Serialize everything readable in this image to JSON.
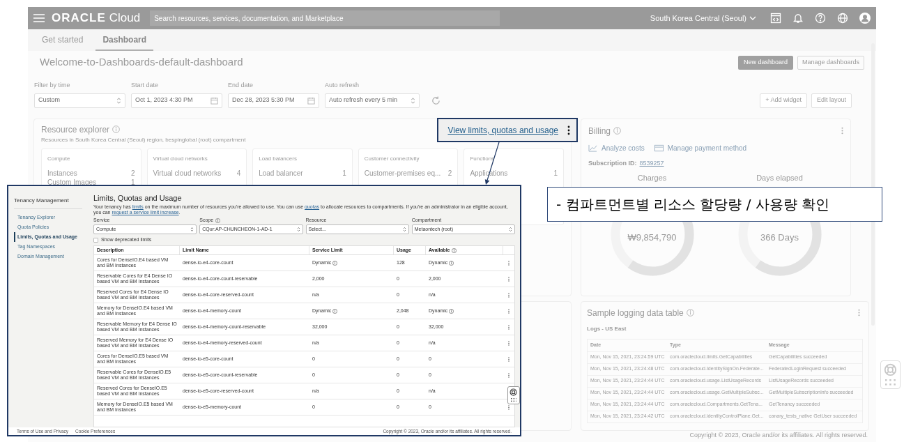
{
  "topbar": {
    "logo_brand": "ORACLE",
    "logo_product": "Cloud",
    "search_placeholder": "Search resources, services, documentation, and Marketplace",
    "region": "South Korea Central (Seoul)"
  },
  "tabs": [
    {
      "label": "Get started",
      "selected": false
    },
    {
      "label": "Dashboard",
      "selected": true
    }
  ],
  "dashboard": {
    "title": "Welcome-to-Dashboards-default-dashboard",
    "buttons": [
      {
        "label": "New dashboard",
        "kind": "primary"
      },
      {
        "label": "Manage dashboards",
        "kind": "secondary"
      }
    ]
  },
  "filters": [
    {
      "label": "Filter by time",
      "value": "Custom",
      "kind": "select"
    },
    {
      "label": "Start date",
      "value": "Oct 1, 2023 4:30 PM",
      "kind": "date"
    },
    {
      "label": "End date",
      "value": "Dec 28, 2023 5:30 PM",
      "kind": "date"
    },
    {
      "label": "Auto refresh",
      "value": "Auto refresh every 5 min",
      "kind": "select"
    }
  ],
  "layout_buttons": [
    "+ Add widget",
    "Edit layout"
  ],
  "resource_explorer": {
    "title": "Resource explorer",
    "subtitle": "Resources in South Korea Central (Seoul) region, bespinglobal (root) compartment",
    "tiles": [
      {
        "title": "Compute",
        "rows": [
          {
            "label": "Instances",
            "count": "2"
          },
          {
            "label": "Custom Images",
            "count": "1"
          }
        ]
      },
      {
        "title": "Virtual cloud networks",
        "rows": [
          {
            "label": "Virtual cloud networks",
            "count": "4"
          }
        ]
      },
      {
        "title": "Load balancers",
        "rows": [
          {
            "label": "Load balancer",
            "count": "1"
          }
        ]
      },
      {
        "title": "Customer connectivity",
        "rows": [
          {
            "label": "Customer-premises eq...",
            "count": "2"
          }
        ]
      },
      {
        "title": "Functions",
        "rows": [
          {
            "label": "Applications",
            "count": "1"
          }
        ]
      }
    ]
  },
  "billing": {
    "title": "Billing",
    "actions": [
      {
        "label": "Analyze costs",
        "kind": "chart"
      },
      {
        "label": "Manage payment method",
        "kind": "card"
      }
    ],
    "subscription_label": "Subscription ID:",
    "subscription_id": "8539257",
    "gauges": [
      {
        "title": "Charges",
        "reading": "₩9,854,790"
      },
      {
        "title": "Days elapsed",
        "reading": "366 Days"
      }
    ]
  },
  "logging": {
    "title": "Sample logging data table",
    "table_title": "Logs - US East",
    "columns": [
      "Date",
      "Type",
      "Message"
    ],
    "rows": [
      [
        "Mon, Nov 15, 2021, 23:24:59 UTC",
        "com.oraclecloud.limits.GetCapabilities",
        "GetCapabilities succeeded"
      ],
      [
        "Mon, Nov 15, 2021, 23:24:48 UTC",
        "com.oraclecloud.IdentitySignOn.Federate...",
        "FederatedLoginRequest succeeded"
      ],
      [
        "Mon, Nov 15, 2021, 23:24:44 UTC",
        "com.oraclecloud.usage.ListUsageRecords",
        "ListUsageRecords succeeded"
      ],
      [
        "Mon, Nov 15, 2021, 23:24:44 UTC",
        "com.oraclecloud.usage.GetMultipleSubsc...",
        "GetMultipleSubscriptionInfo succeeded"
      ],
      [
        "Mon, Nov 15, 2021, 23:24:44 UTC",
        "com.oraclecloud.Compartments.GetTena...",
        "GetTenancy succeeded"
      ],
      [
        "Mon, Nov 15, 2021, 23:24:42 UTC",
        "com.oraclecloud.identityControlPlane.Get...",
        "canary_tests_native GetUser succeeded"
      ]
    ]
  },
  "footer": "Copyright © 2023, Oracle and/or its affiliates. All rights reserved.",
  "callout": {
    "link": "View limits, quotas and usage"
  },
  "annotation": "- 컴파트먼트별 리소스 할당량 / 사용량 확인",
  "inset": {
    "sidebar_title": "Tenancy Management",
    "nav": [
      {
        "label": "Tenancy Explorer",
        "selected": false
      },
      {
        "label": "Quota Policies",
        "selected": false
      },
      {
        "label": "Limits, Quotas and Usage",
        "selected": true
      },
      {
        "label": "Tag Namespaces",
        "selected": false
      },
      {
        "label": "Domain Management",
        "selected": false
      }
    ],
    "title": "Limits, Quotas and Usage",
    "description": [
      {
        "text": "Your tenancy has ",
        "link": false
      },
      {
        "text": "limits",
        "link": true
      },
      {
        "text": " on the maximum number of resources you're allowed to use. You can use ",
        "link": false
      },
      {
        "text": "quotas",
        "link": true
      },
      {
        "text": " to allocate resources to compartments. If you're an administrator in an eligible account, you can ",
        "link": false
      },
      {
        "text": "request a service limit increase",
        "link": true
      },
      {
        "text": ".",
        "link": false
      }
    ],
    "selects": [
      {
        "label": "Service",
        "value": "Compute",
        "info": false
      },
      {
        "label": "Scope",
        "value": "CQur:AP-CHUNCHEON-1-AD-1",
        "info": true
      },
      {
        "label": "Resource",
        "value": "Select...",
        "info": false
      },
      {
        "label": "Compartment",
        "value": "Metaontech (root)",
        "info": false
      }
    ],
    "deprecated": {
      "label": "Show deprecated limits",
      "checked": false
    },
    "columns": [
      {
        "label": "Description",
        "info": false
      },
      {
        "label": "Limit Name",
        "info": false
      },
      {
        "label": "Service Limit",
        "info": false
      },
      {
        "label": "Usage",
        "info": false
      },
      {
        "label": "Available",
        "info": true
      }
    ],
    "rows": [
      {
        "description": "Cores for DenseIO.E4 based VM and BM Instances",
        "limit_name": "dense-io-e4-core-count",
        "service_limit": "Dynamic",
        "usage": "128",
        "available": "Dynamic",
        "info": true
      },
      {
        "description": "Reservable Cores for E4 Dense IO based VM and BM Instances",
        "limit_name": "dense-io-e4-core-count-reservable",
        "service_limit": "2,000",
        "usage": "0",
        "available": "2,000",
        "info": false
      },
      {
        "description": "Reserved Cores for E4 Dense IO based VM and BM Instances",
        "limit_name": "dense-io-e4-core-reserved-count",
        "service_limit": "n/a",
        "usage": "0",
        "available": "n/a",
        "info": false
      },
      {
        "description": "Memory for DenseIO.E4 based VM and BM Instances",
        "limit_name": "dense-io-e4-memory-count",
        "service_limit": "Dynamic",
        "usage": "2,048",
        "available": "Dynamic",
        "info": true
      },
      {
        "description": "Reservable Memory for E4 Dense IO based VM and BM Instances",
        "limit_name": "dense-io-e4-memory-count-reservable",
        "service_limit": "32,000",
        "usage": "0",
        "available": "32,000",
        "info": false
      },
      {
        "description": "Reserved Memory for E4 Dense IO based VM and BM Instances",
        "limit_name": "dense-io-e4-memory-reserved-count",
        "service_limit": "n/a",
        "usage": "0",
        "available": "n/a",
        "info": false
      },
      {
        "description": "Cores for DenseIO.E5 based VM and BM Instances",
        "limit_name": "dense-io-e5-core-count",
        "service_limit": "0",
        "usage": "0",
        "available": "0",
        "info": false
      },
      {
        "description": "Reservable Cores for DenseIO.E5 based VM and BM Instances",
        "limit_name": "dense-io-e5-core-count-reservable",
        "service_limit": "0",
        "usage": "0",
        "available": "0",
        "info": false
      },
      {
        "description": "Reserved Cores for DenseIO.E5 based VM and BM Instances",
        "limit_name": "dense-io-e5-core-reserved-count",
        "service_limit": "n/a",
        "usage": "0",
        "available": "n/a",
        "info": false
      },
      {
        "description": "Memory for DenseIO.E5 based VM and BM Instances",
        "limit_name": "dense-io-e5-memory-count",
        "service_limit": "0",
        "usage": "0",
        "available": "0",
        "info": false
      }
    ],
    "footer_links": [
      "Terms of Use and Privacy",
      "Cookie Preferences"
    ],
    "copyright": "Copyright © 2023, Oracle and/or its affiliates. All rights reserved."
  }
}
